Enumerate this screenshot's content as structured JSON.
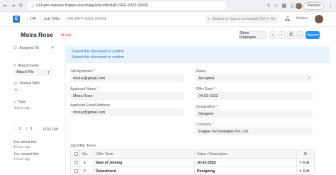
{
  "browser": {
    "url": "v14-pre-release.frappe.cloud/app/job-offer/HR-OFF-2022-00001",
    "status_label": "Paused"
  },
  "navbar": {
    "logo_letter": "E",
    "breadcrumbs": [
      "HR",
      "Job Offer",
      "HR-OFF-2022-00001"
    ],
    "search_placeholder": "Search or type a command (Ctrl + G)",
    "help_label": "Help"
  },
  "page": {
    "title": "Moira Rose",
    "status_badge": "Draft",
    "show_employee_label": "Show Employee",
    "submit_label": "Submit"
  },
  "sidebar": {
    "assigned_to_label": "Assigned To",
    "attachments_label": "Attachments",
    "attach_file_label": "Attach File",
    "shared_with_label": "Shared With",
    "tags_label": "Tags",
    "add_tag_label": "Add a tag ...",
    "likes_count": "0",
    "comments_count": "0",
    "follow_label": "FOLLOW",
    "activity": [
      {
        "line1": "You edited this",
        "line2": "1 hour ago"
      },
      {
        "line1": "You created this",
        "line2": "1 hour ago"
      }
    ]
  },
  "alert": {
    "lines": [
      "Submit this document to confirm",
      "Submit this document to confirm"
    ]
  },
  "form": {
    "job_applicant_label": "Job Applicant",
    "job_applicant_value": "moirar@gmail.com",
    "applicant_name_label": "Applicant Name",
    "applicant_name_value": "Moira Rose",
    "applicant_email_label": "Applicant Email Address",
    "applicant_email_value": "moirar@gmail.com",
    "status_label": "Status",
    "status_value": "Accepted",
    "offer_date_label": "Offer Date",
    "offer_date_value": "04-02-2022",
    "designation_label": "Designation",
    "designation_value": "Designer",
    "company_label": "Company",
    "company_value": "Frappe Technologies Pvt. Ltd."
  },
  "terms": {
    "section_label": "Job Offer Terms",
    "columns": [
      "No.",
      "Offer Term",
      "Value / Description"
    ],
    "rows": [
      {
        "no": "1",
        "term": "Date of Joining",
        "value": "10-02-2022",
        "action": "Edit"
      },
      {
        "no": "2",
        "term": "Department",
        "value": "Designing",
        "action": "Edit"
      }
    ]
  },
  "colors": {
    "primary": "#2490ef",
    "alert_bg": "#e8f3fd",
    "alert_text": "#2479c6",
    "draft_text": "#e24c4c"
  }
}
